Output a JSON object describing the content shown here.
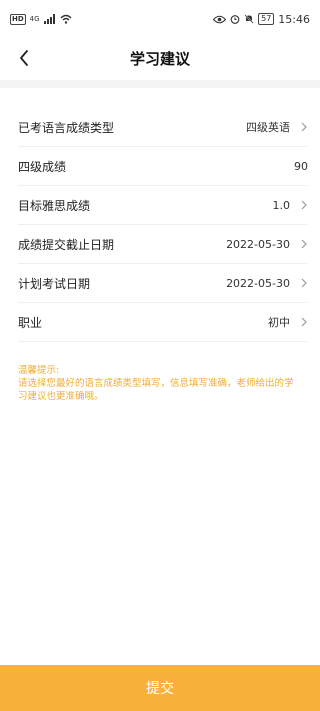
{
  "status_bar": {
    "badge": "HD",
    "network": "4G",
    "battery": "57",
    "time": "15:46"
  },
  "header": {
    "title": "学习建议"
  },
  "form": {
    "rows": [
      {
        "label": "已考语言成绩类型",
        "value": "四级英语",
        "has_chevron": true
      },
      {
        "label": "四级成绩",
        "value": "90",
        "has_chevron": false
      },
      {
        "label": "目标雅思成绩",
        "value": "1.0",
        "has_chevron": true
      },
      {
        "label": "成绩提交截止日期",
        "value": "2022-05-30",
        "has_chevron": true
      },
      {
        "label": "计划考试日期",
        "value": "2022-05-30",
        "has_chevron": true
      },
      {
        "label": "职业",
        "value": "初中",
        "has_chevron": true
      }
    ]
  },
  "tips": {
    "title": "温馨提示:",
    "text": "请选择您最好的语言成绩类型填写，信息填写准确，老师给出的学习建议也更准确哦。"
  },
  "footer": {
    "submit_label": "提交"
  },
  "colors": {
    "accent": "#f9b13c",
    "tip_text": "#f0ad31"
  }
}
